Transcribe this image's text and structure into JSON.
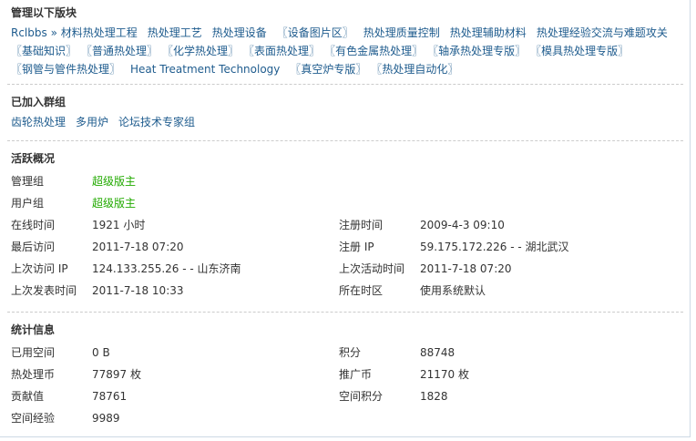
{
  "sections": {
    "managed": {
      "title": "管理以下版块",
      "links": [
        "Rclbbs » 材料热处理工程",
        "热处理工艺",
        "热处理设备",
        "〖设备图片区〗",
        "热处理质量控制",
        "热处理辅助材料",
        "热处理经验交流与难题攻关",
        "〖基础知识〗",
        "〖普通热处理〗",
        "〖化学热处理〗",
        "〖表面热处理〗",
        "〖有色金属热处理〗",
        "〖轴承热处理专版〗",
        "〖模具热处理专版〗",
        "〖钢管与管件热处理〗",
        "Heat Treatment Technology",
        "〖真空炉专版〗",
        "〖热处理自动化〗"
      ]
    },
    "groups": {
      "title": "已加入群组",
      "links": [
        "齿轮热处理",
        "多用炉",
        "论坛技术专家组"
      ]
    },
    "activity": {
      "title": "活跃概况",
      "manage_group_label": "管理组",
      "manage_group_value": "超级版主",
      "user_group_label": "用户组",
      "user_group_value": "超级版主",
      "left": [
        {
          "label": "在线时间",
          "value": "1921 小时"
        },
        {
          "label": "最后访问",
          "value": "2011-7-18 07:20"
        },
        {
          "label": "上次访问 IP",
          "value": "124.133.255.26 - - 山东济南"
        },
        {
          "label": "上次发表时间",
          "value": "2011-7-18 10:33"
        }
      ],
      "right": [
        {
          "label": "注册时间",
          "value": "2009-4-3 09:10"
        },
        {
          "label": "注册 IP",
          "value": "59.175.172.226 - - 湖北武汉"
        },
        {
          "label": "上次活动时间",
          "value": "2011-7-18 07:20"
        },
        {
          "label": "所在时区",
          "value": "使用系统默认"
        }
      ]
    },
    "stats": {
      "title": "统计信息",
      "left": [
        {
          "label": "已用空间",
          "value": "0 B"
        },
        {
          "label": "热处理币",
          "value": "77897 枚"
        },
        {
          "label": "贡献值",
          "value": "78761"
        },
        {
          "label": "空间经验",
          "value": "9989"
        }
      ],
      "right": [
        {
          "label": "积分",
          "value": "88748"
        },
        {
          "label": "推广币",
          "value": "21170 枚"
        },
        {
          "label": "空间积分",
          "value": "1828"
        }
      ]
    }
  },
  "colors": {
    "link": "#1f5c8e",
    "group_highlight": "#22aa00",
    "divider": "#cccccc"
  }
}
